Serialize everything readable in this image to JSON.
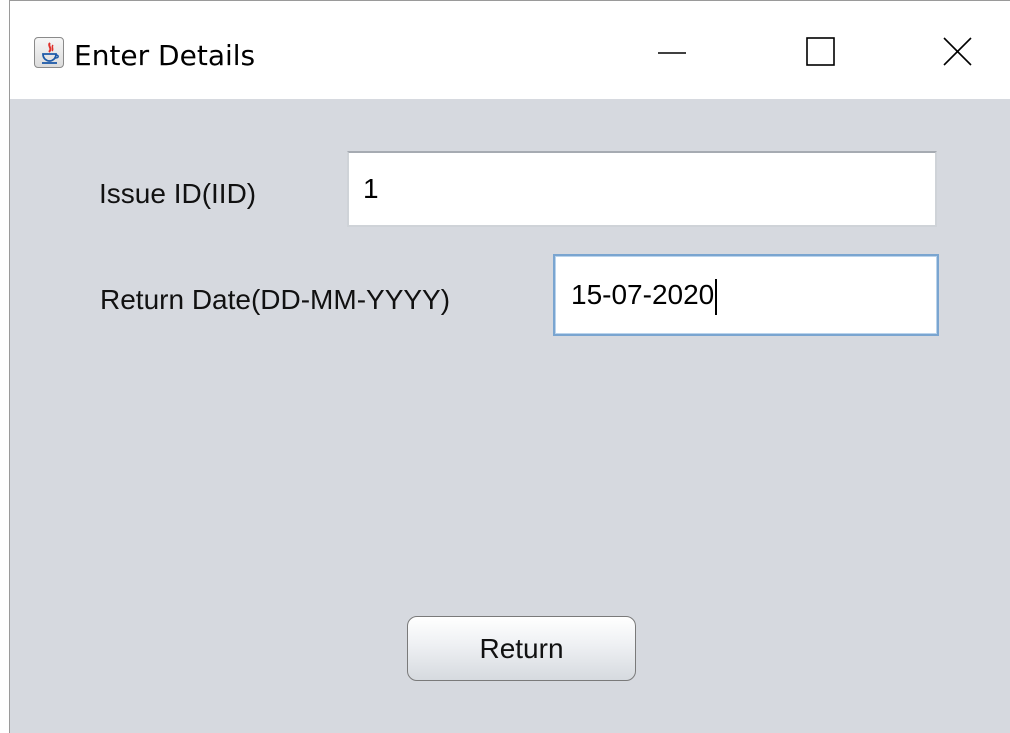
{
  "window": {
    "title": "Enter Details",
    "app_icon": "java-icon",
    "controls": [
      "minimize-icon",
      "maximize-icon",
      "close-icon"
    ]
  },
  "form": {
    "issue_id_label": "Issue ID(IID)",
    "issue_id_value": "1",
    "return_date_label": "Return Date(DD-MM-YYYY)",
    "return_date_value": "15-07-2020"
  },
  "actions": {
    "return_label": "Return"
  },
  "colors": {
    "window_bg": "#d6d9df",
    "focus_border": "#7aa5d0"
  }
}
